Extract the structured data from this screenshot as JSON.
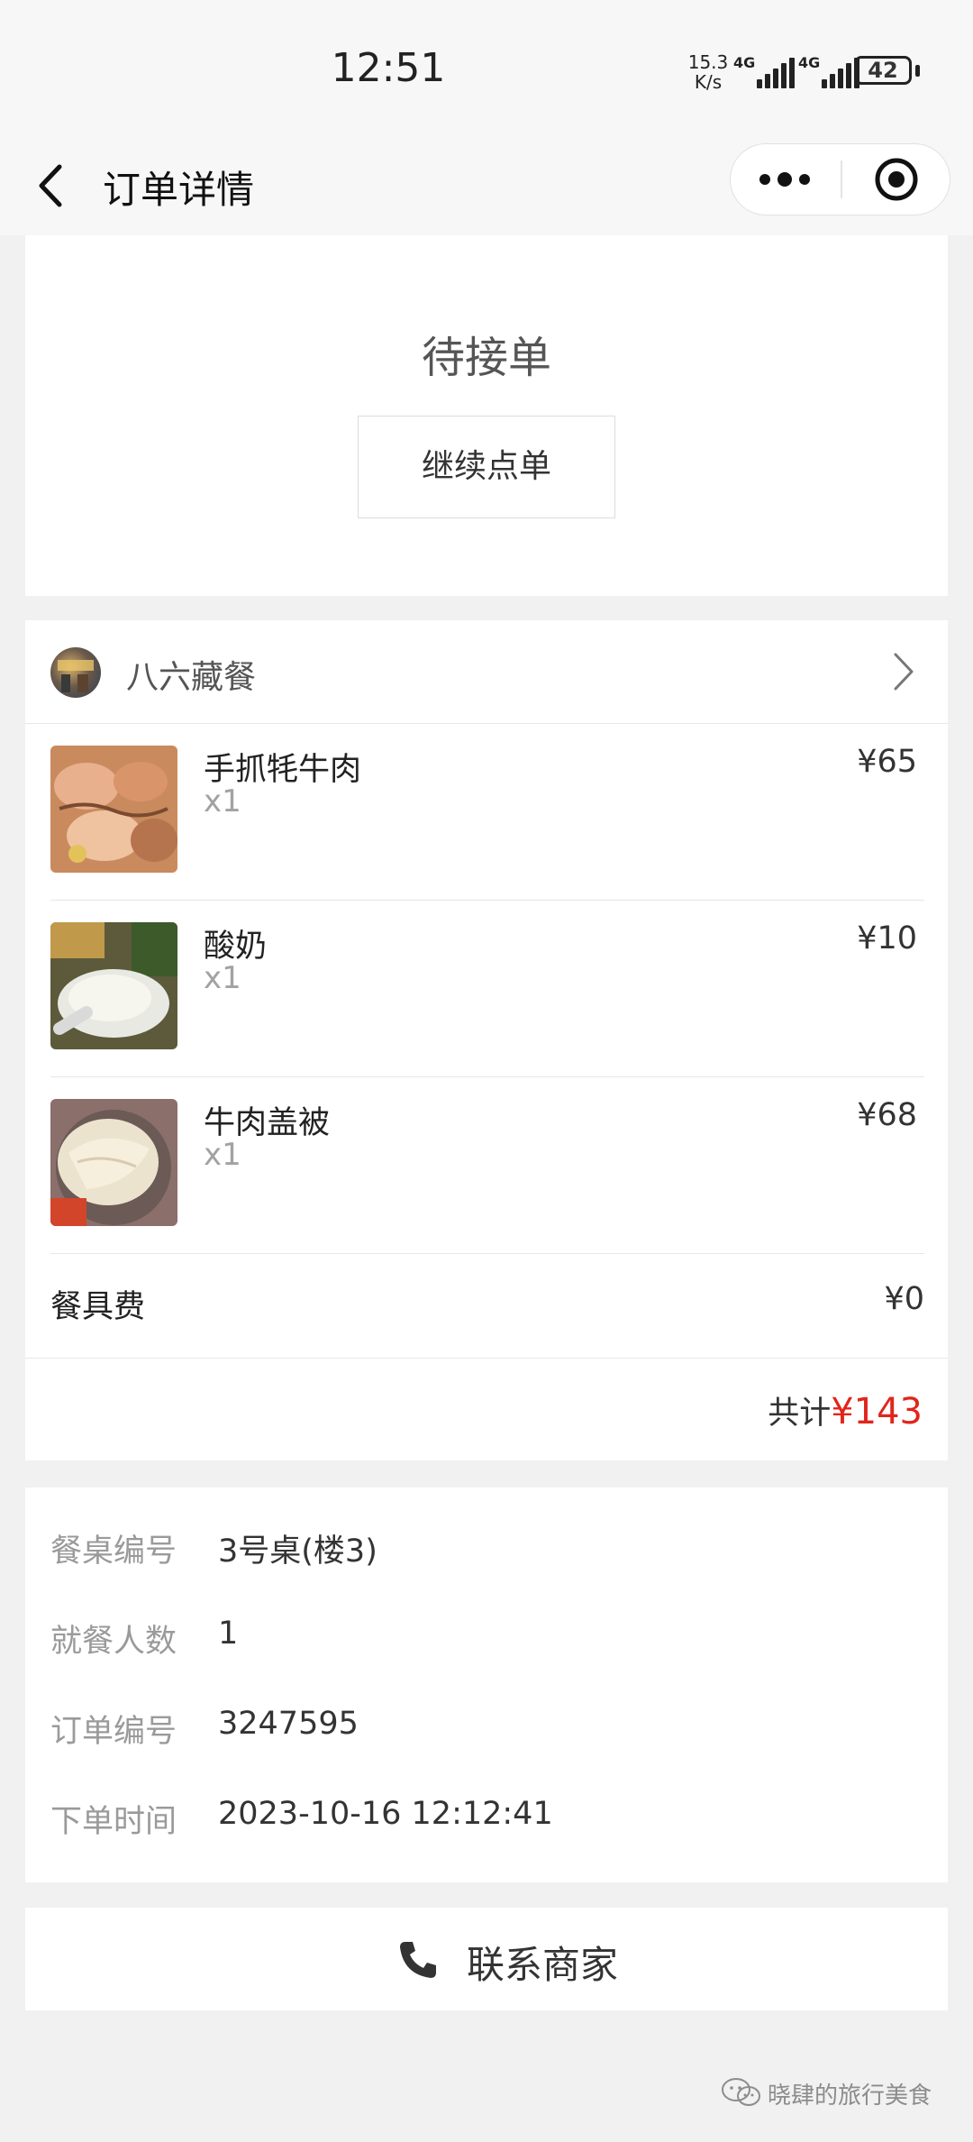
{
  "status_bar": {
    "time": "12:51",
    "net_speed_value": "15.3",
    "net_speed_unit": "K/s",
    "sim1_label": "4G",
    "sim2_label": "4G",
    "battery": "42"
  },
  "nav": {
    "title": "订单详情"
  },
  "order_status": {
    "status_text": "待接单",
    "continue_label": "继续点单"
  },
  "shop": {
    "name": "八六藏餐"
  },
  "items": [
    {
      "name": "手抓牦牛肉",
      "qty": "x1",
      "price": "¥65"
    },
    {
      "name": "酸奶",
      "qty": "x1",
      "price": "¥10"
    },
    {
      "name": "牛肉盖被",
      "qty": "x1",
      "price": "¥68"
    }
  ],
  "fee": {
    "label": "餐具费",
    "value": "¥0"
  },
  "total": {
    "label": "共计",
    "amount": "¥143"
  },
  "info": {
    "table_label": "餐桌编号",
    "table_value": "3号桌(楼3)",
    "guests_label": "就餐人数",
    "guests_value": "1",
    "order_no_label": "订单编号",
    "order_no_value": "3247595",
    "time_label": "下单时间",
    "time_value": "2023-10-16 12:12:41"
  },
  "contact": {
    "label": "联系商家"
  },
  "watermark": {
    "text": "晓肆的旅行美食"
  },
  "colors": {
    "accent_price": "#e1251b",
    "background": "#f1f1f1"
  }
}
